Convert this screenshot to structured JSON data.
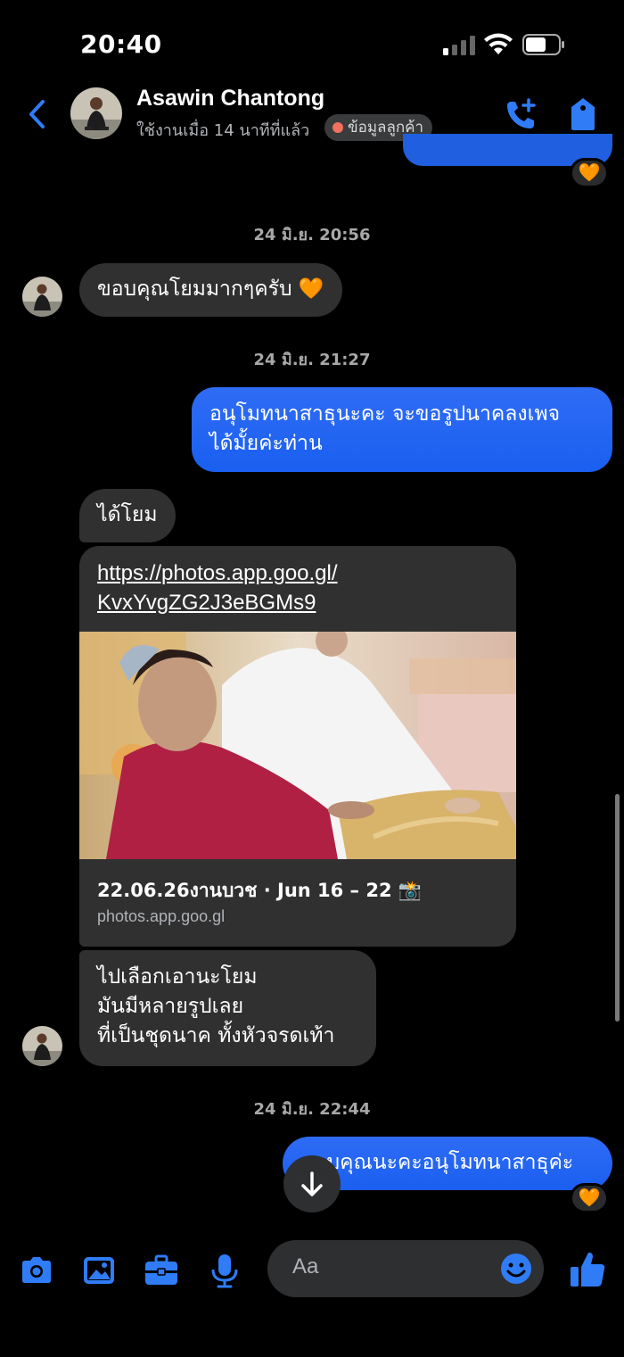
{
  "status_bar": {
    "time": "20:40"
  },
  "header": {
    "contact_name": "Asawin Chantong",
    "last_active": "ใช้งานเมื่อ 14 นาทีที่แล้ว",
    "customer_tag": "ข้อมูลลูกค้า"
  },
  "top_reaction": "🧡",
  "messages": {
    "ts1": "24 มิ.ย. 20:56",
    "m1": "ขอบคุณโยมมากๆครับ 🧡",
    "ts2": "24 มิ.ย. 21:27",
    "m2_line1": "อนุโมทนาสาธุนะคะ จะขอรูปนาคลงเพจ",
    "m2_line2": "ได้มั้ยค่ะท่าน",
    "m3": "ได้โยม",
    "link_url_line1": "https://photos.app.goo.gl/",
    "link_url_line2": "KvxYvgZG2J3eBGMs9",
    "link_title": "22.06.26งานบวช · Jun 16 – 22 📸",
    "link_domain": "photos.app.goo.gl",
    "m4_line1": "ไปเลือกเอานะโยม",
    "m4_line2": "มันมีหลายรูปเลย",
    "m4_line3": "ที่เป็นชุดนาค ทั้งหัวจรดเท้า",
    "ts3": "24 มิ.ย. 22:44",
    "m5": "ขอบคุณนะคะอนุโมทนาสาธุค่ะ",
    "m5_reaction": "🧡"
  },
  "composer": {
    "placeholder": "Aa"
  },
  "colors": {
    "accent": "#1a5ff0",
    "background": "#000000",
    "incoming_bubble": "#303030",
    "icon_blue": "#3b82f6"
  }
}
